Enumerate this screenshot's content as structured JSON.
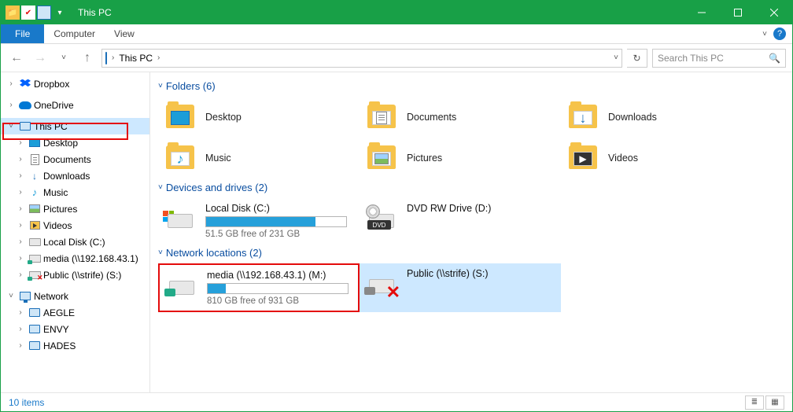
{
  "titlebar": {
    "title": "This PC"
  },
  "menubar": {
    "file": "File",
    "computer": "Computer",
    "view": "View"
  },
  "nav": {
    "location": "This PC",
    "search_placeholder": "Search This PC"
  },
  "sidebar": {
    "dropbox": "Dropbox",
    "onedrive": "OneDrive",
    "thispc": "This PC",
    "desktop": "Desktop",
    "documents": "Documents",
    "downloads": "Downloads",
    "music": "Music",
    "pictures": "Pictures",
    "videos": "Videos",
    "localdisk": "Local Disk (C:)",
    "media": "media (\\\\192.168.43.1)",
    "public": "Public (\\\\strife) (S:)",
    "network": "Network",
    "aegle": "AEGLE",
    "envy": "ENVY",
    "hades": "HADES"
  },
  "groups": {
    "folders": "Folders (6)",
    "drives": "Devices and drives (2)",
    "network": "Network locations (2)"
  },
  "folders": {
    "desktop": "Desktop",
    "documents": "Documents",
    "downloads": "Downloads",
    "music": "Music",
    "pictures": "Pictures",
    "videos": "Videos"
  },
  "drives": {
    "local": {
      "name": "Local Disk (C:)",
      "sub": "51.5 GB free of 231 GB",
      "fill_pct": 78
    },
    "dvd": {
      "name": "DVD RW Drive (D:)"
    }
  },
  "netloc": {
    "media": {
      "name": "media (\\\\192.168.43.1) (M:)",
      "sub": "810 GB free of 931 GB",
      "fill_pct": 13
    },
    "public": {
      "name": "Public (\\\\strife) (S:)"
    }
  },
  "status": {
    "text": "10 items"
  }
}
